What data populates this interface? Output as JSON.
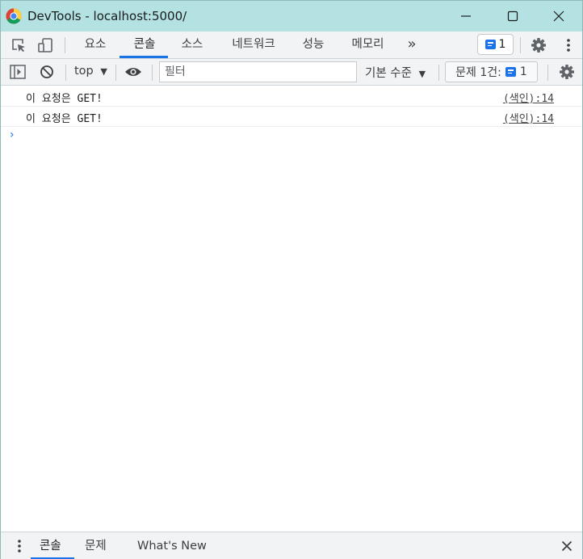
{
  "window": {
    "title": "DevTools - localhost:5000/"
  },
  "icons": {
    "app": "chrome-icon",
    "minimize": "minimize-icon",
    "maximize": "maximize-icon",
    "close": "close-icon"
  },
  "tabs": {
    "items": [
      {
        "label": "요소"
      },
      {
        "label": "콘솔",
        "active": true
      },
      {
        "label": "소스"
      },
      {
        "label": "네트워크"
      },
      {
        "label": "성능"
      },
      {
        "label": "메모리"
      }
    ],
    "overflow": "»",
    "issues_count": "1"
  },
  "toolbar": {
    "context": "top",
    "filter_placeholder": "필터",
    "level": "기본 수준",
    "issues_label": "문제 1건:",
    "issues_count": "1"
  },
  "console": {
    "messages": [
      {
        "text": "이 요청은 GET!",
        "source": "(색인):14"
      },
      {
        "text": "이 요청은 GET!",
        "source": "(색인):14"
      }
    ],
    "prompt": "›"
  },
  "drawer": {
    "tabs": [
      {
        "label": "콘솔",
        "active": true
      },
      {
        "label": "문제"
      },
      {
        "label": "What's New"
      }
    ]
  },
  "colors": {
    "titlebar": "#b4e1e1",
    "accent": "#1a73e8",
    "toolbar": "#f1f3f4"
  }
}
